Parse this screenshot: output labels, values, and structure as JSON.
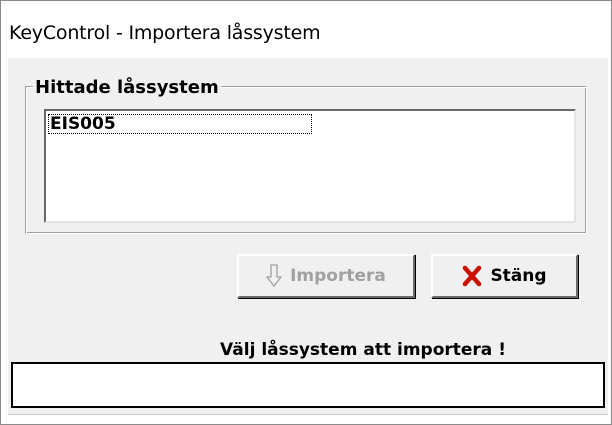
{
  "window": {
    "title": "KeyControl - Importera låssystem"
  },
  "lock_systems_group": {
    "legend": "Hittade låssystem",
    "items": [
      {
        "label": "EIS005",
        "focused": true
      }
    ]
  },
  "buttons": {
    "import_label": "Importera",
    "import_enabled": false,
    "import_icon": "arrow-down-icon",
    "close_label": "Stäng",
    "close_icon": "red-x-icon"
  },
  "status": {
    "message": "Välj låssystem att importera !",
    "value": ""
  },
  "colors": {
    "dialog_background": "#f0f0f0",
    "close_icon": "#cc1100",
    "disabled_text": "#a0a0a0"
  }
}
